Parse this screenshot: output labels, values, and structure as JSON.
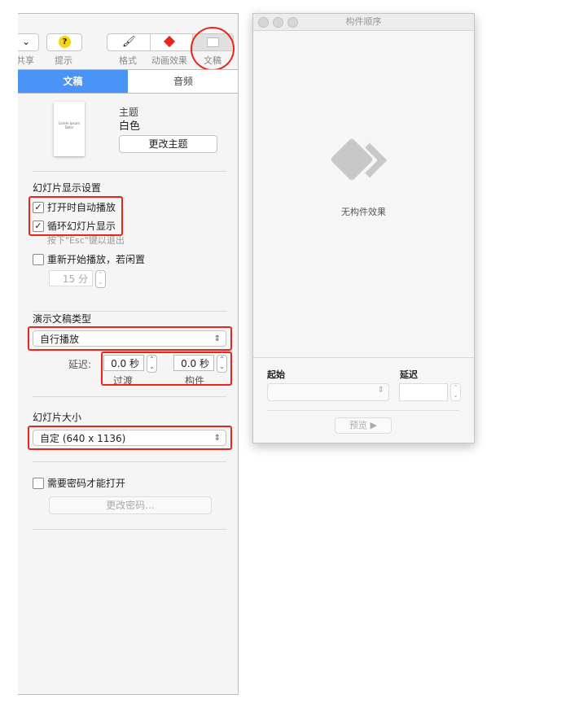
{
  "toolbar": {
    "share": "共享",
    "tips": "提示",
    "format": "格式",
    "animate": "动画效果",
    "document": "文稿",
    "tips_icon": "?"
  },
  "tabs": {
    "document": "文稿",
    "audio": "音频"
  },
  "theme": {
    "label": "主题",
    "name": "白色",
    "change": "更改主题",
    "thumb_title": "Lorem Ipsum Dolor"
  },
  "slideshow": {
    "title": "幻灯片显示设置",
    "autoplay": "打开时自动播放",
    "autoplay_checked": true,
    "loop": "循环幻灯片显示",
    "loop_checked": true,
    "esc_hint": "按下\"Esc\"键以退出",
    "restart": "重新开始播放，若闲置",
    "restart_checked": false,
    "idle_value": "15 分"
  },
  "presentation": {
    "title": "演示文稿类型",
    "type": "自行播放",
    "delay_label": "延迟:",
    "transition_value": "0.0 秒",
    "transition_label": "过渡",
    "build_value": "0.0 秒",
    "build_label": "构件"
  },
  "size": {
    "title": "幻灯片大小",
    "value": "自定 (640 x 1136)"
  },
  "password": {
    "label": "需要密码才能打开",
    "checked": false,
    "change": "更改密码..."
  },
  "build_window": {
    "title": "构件顺序",
    "empty": "无构件效果",
    "start_label": "起始",
    "delay_label": "延迟",
    "preview": "预览"
  },
  "colors": {
    "accent": "#4a94f6",
    "highlight": "#e8261c"
  }
}
